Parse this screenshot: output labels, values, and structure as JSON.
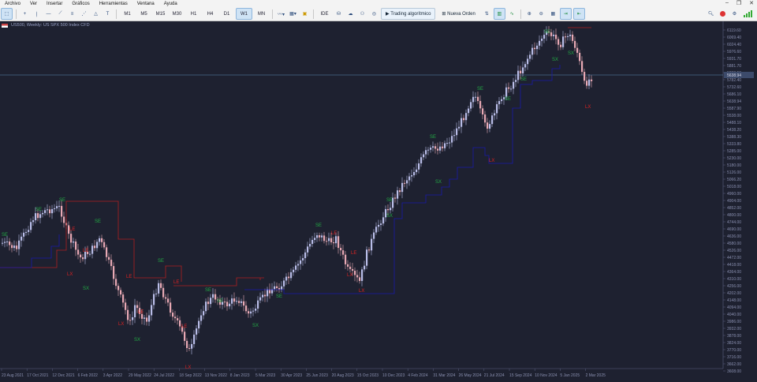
{
  "menu": [
    "Archivo",
    "Ver",
    "Insertar",
    "Gráficos",
    "Herramientas",
    "Ventana",
    "Ayuda"
  ],
  "timeframes": [
    "M1",
    "M5",
    "M15",
    "M30",
    "H1",
    "H4",
    "D1",
    "W1",
    "MN"
  ],
  "active_timeframe": "W1",
  "toolbar": {
    "ide": "IDE",
    "algo": "Trading algorítmico",
    "order": "Nueva Orden"
  },
  "chart_label": "US500, Weekly: US SPX 500 Index CFD",
  "current_price": "5638.94",
  "price_ticks": [
    "6119.60",
    "6069.40",
    "6024.40",
    "5976.60",
    "5931.70",
    "5881.70",
    "5833.50",
    "5782.40",
    "5732.60",
    "5686.10",
    "5638.94",
    "5587.90",
    "5538.00",
    "5488.10",
    "5438.20",
    "5388.30",
    "5333.80",
    "5285.00",
    "5230.00",
    "5180.00",
    "5126.00",
    "5066.20",
    "5018.00",
    "4960.00",
    "4904.00",
    "4852.00",
    "4800.00",
    "4744.00",
    "4690.00",
    "4636.00",
    "4580.00",
    "4526.00",
    "4472.00",
    "4418.00",
    "4364.00",
    "4310.00",
    "4256.00",
    "4202.00",
    "4148.00",
    "4094.00",
    "4040.00",
    "3986.00",
    "3932.00",
    "3878.00",
    "3824.00",
    "3770.00",
    "3716.00",
    "3662.00",
    "3608.00"
  ],
  "date_labels": [
    "23 Aug 2021",
    "17 Oct 2021",
    "12 Dec 2021",
    "6 Feb 2022",
    "3 Apr 2022",
    "29 May 2022",
    "24 Jul 2022",
    "18 Sep 2022",
    "13 Nov 2022",
    "8 Jan 2023",
    "5 Mar 2023",
    "30 Apr 2023",
    "25 Jun 2023",
    "20 Aug 2023",
    "15 Oct 2023",
    "10 Dec 2023",
    "4 Feb 2024",
    "31 Mar 2024",
    "26 May 2024",
    "21 Jul 2024",
    "15 Sep 2024",
    "10 Nov 2024",
    "5 Jan 2025",
    "2 Mar 2025"
  ],
  "signal_labels": [
    "SE",
    "LE",
    "SX",
    "LX"
  ],
  "colors": {
    "bg": "#1e2130",
    "bull": "#b9bde8",
    "bear": "#e8a9b4",
    "stop_up": "#1a1aa8",
    "stop_down": "#b02020",
    "sig_up": "#22aa44",
    "sig_down": "#dd2222",
    "grid": "#2a2e40",
    "price_line": "#5a8fb8"
  }
}
